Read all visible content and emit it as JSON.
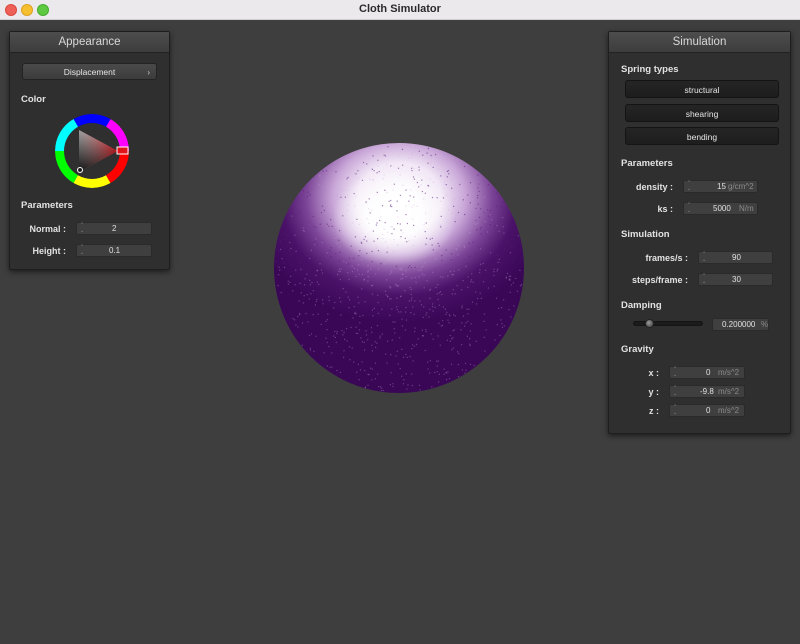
{
  "window": {
    "title": "Cloth Simulator"
  },
  "appearance": {
    "header": "Appearance",
    "shader_select": "Displacement",
    "color_label": "Color",
    "parameters_label": "Parameters",
    "normal": {
      "label": "Normal :",
      "value": "2"
    },
    "height": {
      "label": "Height :",
      "value": "0.1"
    },
    "selected_color": "#e0141b"
  },
  "simulation": {
    "header": "Simulation",
    "spring_types_label": "Spring types",
    "spring_buttons": [
      "structural",
      "shearing",
      "bending"
    ],
    "parameters_label": "Parameters",
    "density": {
      "label": "density :",
      "value": "15",
      "unit": "g/cm^2"
    },
    "ks": {
      "label": "ks :",
      "value": "5000",
      "unit": "N/m"
    },
    "simulation_label": "Simulation",
    "frames": {
      "label": "frames/s :",
      "value": "90"
    },
    "steps": {
      "label": "steps/frame :",
      "value": "30"
    },
    "damping_label": "Damping",
    "damping": {
      "value": "0.200000",
      "unit": "%",
      "fraction": 0.2
    },
    "gravity_label": "Gravity",
    "gx": {
      "label": "x :",
      "value": "0",
      "unit": "m/s^2"
    },
    "gy": {
      "label": "y :",
      "value": "-9.8",
      "unit": "m/s^2"
    },
    "gz": {
      "label": "z :",
      "value": "0",
      "unit": "m/s^2"
    }
  },
  "colors": {
    "sphere_light": "#ffffff",
    "sphere_dark": "#3a0757",
    "background": "#3e3e3e"
  }
}
